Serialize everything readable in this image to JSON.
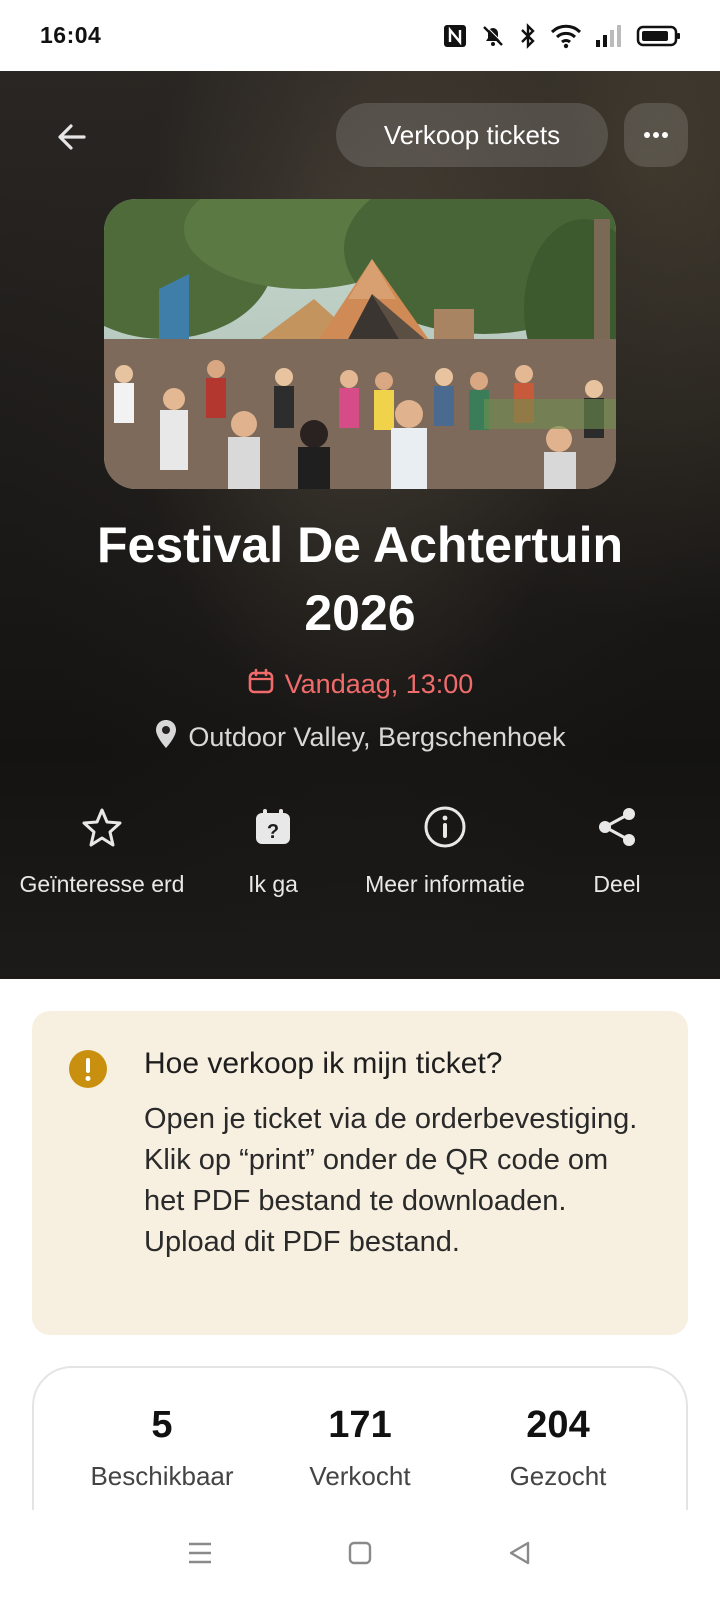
{
  "status_bar": {
    "time": "16:04",
    "icons": [
      "nfc-icon",
      "mute-icon",
      "bluetooth-icon",
      "wifi-icon",
      "signal-icon",
      "battery-icon"
    ]
  },
  "header": {
    "back_icon": "arrow-left-icon",
    "sell_tickets_label": "Verkoop tickets",
    "more_icon": "more-horizontal-icon"
  },
  "event": {
    "title": "Festival De Achtertuin 2026",
    "date": "Vandaag, 13:00",
    "date_icon": "calendar-icon",
    "location": "Outdoor Valley, Bergschenhoek",
    "location_icon": "map-pin-icon",
    "date_color": "#f06b6b"
  },
  "actions": [
    {
      "label": "Geïnteresse erd",
      "icon": "star-icon"
    },
    {
      "label": "Ik ga",
      "icon": "calendar-question-icon"
    },
    {
      "label": "Meer informatie",
      "icon": "info-circle-icon"
    },
    {
      "label": "Deel",
      "icon": "share-icon"
    }
  ],
  "info_card": {
    "icon": "exclamation-circle-icon",
    "title": "Hoe verkoop ik mijn ticket?",
    "body": "Open je ticket via de orderbevestiging. Klik op “print” onder de QR code om het PDF bestand te downloaden. Upload dit PDF bestand.",
    "background": "#f7efe0",
    "icon_color": "#c9900f"
  },
  "stats": [
    {
      "value": "5",
      "label": "Beschikbaar"
    },
    {
      "value": "171",
      "label": "Verkocht"
    },
    {
      "value": "204",
      "label": "Gezocht"
    }
  ],
  "nav_bar": {
    "icons": [
      "menu-icon",
      "home-square-icon",
      "back-triangle-icon"
    ]
  }
}
